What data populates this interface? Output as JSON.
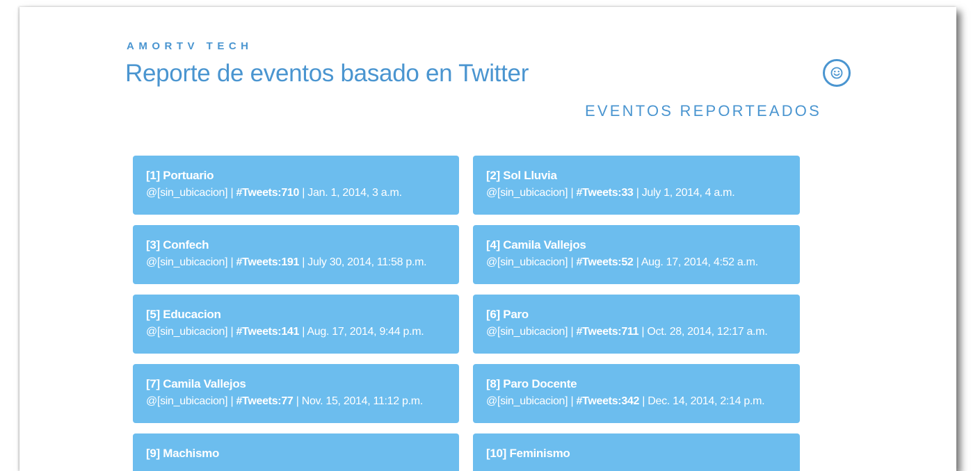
{
  "header": {
    "brand": "AMORTV TECH",
    "title": "Reporte de eventos basado en Twitter",
    "user_icon": "smiley-icon"
  },
  "section": {
    "title": "EVENTOS REPORTEADOS"
  },
  "colors": {
    "accent": "#4a95d0",
    "card_bg": "#6cbdee",
    "card_text": "#ffffff"
  },
  "events": [
    {
      "title": "[1] Portuario",
      "location": "@[sin_ubicacion]",
      "sep1": " | ",
      "tweets": "#Tweets:710",
      "sep2": " | ",
      "date": "Jan. 1, 2014, 3 a.m."
    },
    {
      "title": "[2] Sol Lluvia",
      "location": "@[sin_ubicacion]",
      "sep1": " | ",
      "tweets": "#Tweets:33",
      "sep2": " | ",
      "date": "July 1, 2014, 4 a.m."
    },
    {
      "title": "[3] Confech",
      "location": "@[sin_ubicacion]",
      "sep1": " | ",
      "tweets": "#Tweets:191",
      "sep2": " | ",
      "date": "July 30, 2014, 11:58 p.m."
    },
    {
      "title": "[4] Camila Vallejos",
      "location": "@[sin_ubicacion]",
      "sep1": " | ",
      "tweets": "#Tweets:52",
      "sep2": " | ",
      "date": "Aug. 17, 2014, 4:52 a.m."
    },
    {
      "title": "[5] Educacion",
      "location": "@[sin_ubicacion]",
      "sep1": " | ",
      "tweets": "#Tweets:141",
      "sep2": " | ",
      "date": "Aug. 17, 2014, 9:44 p.m."
    },
    {
      "title": "[6] Paro",
      "location": "@[sin_ubicacion]",
      "sep1": " | ",
      "tweets": "#Tweets:711",
      "sep2": " | ",
      "date": "Oct. 28, 2014, 12:17 a.m."
    },
    {
      "title": "[7] Camila Vallejos",
      "location": "@[sin_ubicacion]",
      "sep1": " | ",
      "tweets": "#Tweets:77",
      "sep2": " | ",
      "date": "Nov. 15, 2014, 11:12 p.m."
    },
    {
      "title": "[8] Paro Docente",
      "location": "@[sin_ubicacion]",
      "sep1": " | ",
      "tweets": "#Tweets:342",
      "sep2": " | ",
      "date": "Dec. 14, 2014, 2:14 p.m."
    },
    {
      "title": "[9] Machismo"
    },
    {
      "title": "[10] Feminismo"
    }
  ]
}
